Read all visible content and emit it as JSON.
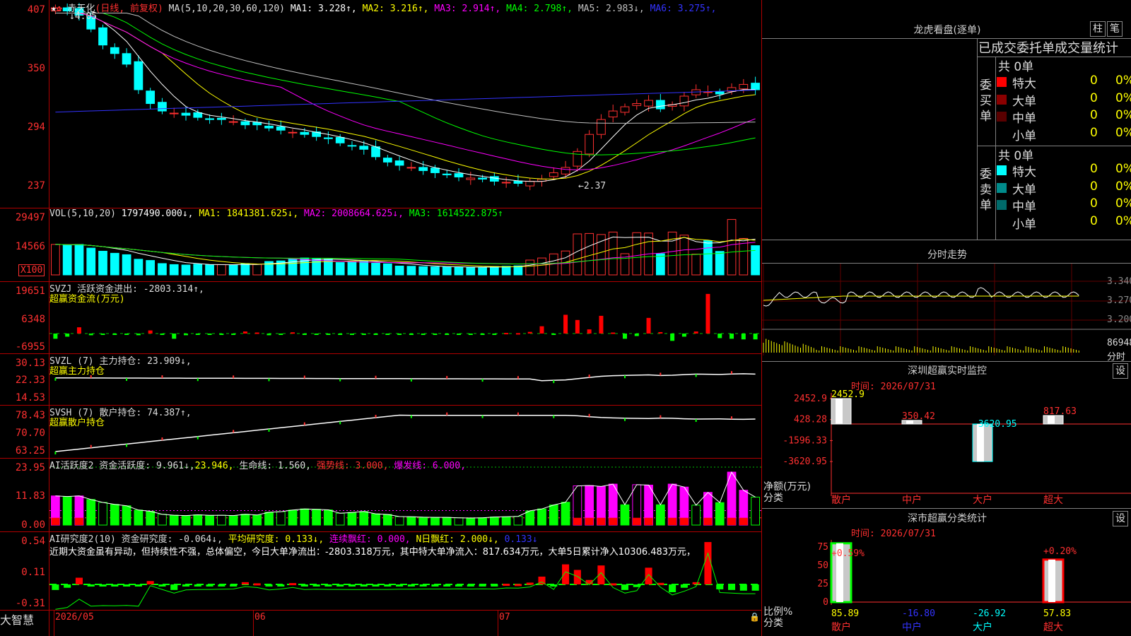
{
  "header": {
    "stock_name": "赤天化",
    "mode": "(日线, 前复权)",
    "ma_label": "MA(5,10,20,30,60,120)",
    "ma": [
      {
        "label": "MA1:",
        "value": "3.228",
        "arrow": "↑",
        "color": "#ffffff"
      },
      {
        "label": "MA2:",
        "value": "3.216",
        "arrow": "↑",
        "color": "#ffff00"
      },
      {
        "label": "MA3:",
        "value": "2.914",
        "arrow": "↑",
        "color": "#ff00ff"
      },
      {
        "label": "MA4:",
        "value": "2.798",
        "arrow": "↑",
        "color": "#00ff00"
      },
      {
        "label": "MA5:",
        "value": "2.983",
        "arrow": "↓",
        "color": "#c0c0c0"
      },
      {
        "label": "MA6:",
        "value": "3.275",
        "arrow": "↑",
        "color": "#3333ff"
      }
    ],
    "high_mark": "4.05",
    "low_mark": "←2.37"
  },
  "price_axis": [
    "407",
    "350",
    "294",
    "237"
  ],
  "vol": {
    "title": "VOL(5,10,20)",
    "value": "1797490.000↓,",
    "ma1": "MA1: 1841381.625↓,",
    "ma2": "MA2: 2008664.625↓,",
    "ma3": "MA3: 1614522.875↑",
    "axis": [
      "29497",
      "14566"
    ],
    "unit": "X100"
  },
  "svzj": {
    "line1": "SVZJ  活跃资金进出: -2803.314↑,",
    "line2": "超赢资金流(万元)",
    "axis": [
      "19651",
      "6348",
      "-6955"
    ]
  },
  "svzl": {
    "line1": "SVZL (7) 主力持仓: 23.909↓,",
    "line2": "超赢主力持仓",
    "axis": [
      "30.13",
      "22.33",
      "14.53"
    ]
  },
  "svsh": {
    "line1": "SVSH (7) 散户持仓: 74.387↑,",
    "line2": "超赢散户持仓",
    "axis": [
      "78.43",
      "70.70",
      "63.25"
    ]
  },
  "ai1": {
    "a": "AI活跃度2 资金活跃度: 9.961↓,",
    "b": "23.946,",
    "c": "生命线: 1.560,",
    "d": "强势线: 3.000,",
    "e": "爆发线: 6.000,",
    "axis": [
      "23.95",
      "11.83",
      "0.00"
    ]
  },
  "ai2": {
    "a": "AI研究度2(10) 资金研究度: -0.064↓,",
    "b": "平均研究度: 0.133↓,",
    "c": "连续飘红: 0.000,",
    "d": "N日飘红: 2.000↓,",
    "e": "0.133↓",
    "text": "近期大资金虽有异动，但持续性不强，总体偏空，今日大单净流出：-2803.318万元，其中特大单净流入：817.634万元，大单5日累计净入10306.483万元，",
    "axis": [
      "0.54",
      "0.11",
      "-0.31"
    ]
  },
  "bottom": {
    "logo": "大智慧",
    "dates": [
      "2026/05",
      "06",
      "07"
    ]
  },
  "right": {
    "longhu_title": "龙虎看盘(逐单)",
    "btn1": "柱",
    "btn2": "笔",
    "tabs_line": "已成交委托单成交量统计",
    "buy_label": [
      "委",
      "买",
      "单"
    ],
    "sell_label": [
      "委",
      "卖",
      "单"
    ],
    "buy_total": "共 0单",
    "sell_total": "共 0单",
    "buy_rows": [
      {
        "name": "特大",
        "n": "0",
        "pct": "0%",
        "color": "#ff0000"
      },
      {
        "name": "大单",
        "n": "0",
        "pct": "0%",
        "color": "#8b0000"
      },
      {
        "name": "中单",
        "n": "0",
        "pct": "0%",
        "color": "#5a0000"
      },
      {
        "name": "小单",
        "n": "0",
        "pct": "0%",
        "color": ""
      }
    ],
    "sell_rows": [
      {
        "name": "特大",
        "n": "0",
        "pct": "0%",
        "color": "#00ffff"
      },
      {
        "name": "大单",
        "n": "0",
        "pct": "0%",
        "color": "#008b8b"
      },
      {
        "name": "中单",
        "n": "0",
        "pct": "0%",
        "color": "#006b6b"
      },
      {
        "name": "小单",
        "n": "0",
        "pct": "0%",
        "color": ""
      }
    ],
    "intraday_title": "分时走势",
    "intraday_axis": [
      "3.340",
      "3.270",
      "3.200"
    ],
    "intraday_vol": "86948",
    "intraday_sub": "分时",
    "sz_title": "深圳超赢实时监控",
    "sz_setting": "设",
    "sz_time": "时间: 2026/07/31",
    "sz_axis": [
      "2452.9",
      "428.28",
      "-1596.33",
      "-3620.95"
    ],
    "sz_values": [
      {
        "label": "2452.9",
        "color": "#ffff00"
      },
      {
        "label": "350.42",
        "color": "#ff3030"
      },
      {
        "label": "-3620.95",
        "color": "#00ffff"
      },
      {
        "label": "817.63",
        "color": "#ff3030"
      }
    ],
    "sz_ylabel": "净额(万元)",
    "sz_xlabel": "分类",
    "sz_cats": [
      "散户",
      "中户",
      "大户",
      "超大"
    ],
    "fl_title": "深市超赢分类统计",
    "fl_setting": "设",
    "fl_time": "时间: 2026/07/31",
    "fl_axis": [
      "75",
      "50",
      "25",
      "0"
    ],
    "fl_top": [
      "+0.59%",
      "+0.20%"
    ],
    "fl_values": [
      {
        "label": "85.89",
        "color": "#ffff00"
      },
      {
        "label": "-16.80",
        "color": "#3333ff"
      },
      {
        "label": "-26.92",
        "color": "#00ffff"
      },
      {
        "label": "57.83",
        "color": "#ffff00"
      }
    ],
    "fl_ylabel": "比例%",
    "fl_xlabel": "分类",
    "fl_cats": [
      "散户",
      "中户",
      "大户",
      "超大"
    ]
  },
  "chart_data": [
    {
      "type": "candlestick",
      "title": "赤天化 (日线, 前复权)",
      "ylim": [
        2.37,
        4.07
      ],
      "close": [
        4.05,
        4.02,
        3.98,
        3.85,
        3.7,
        3.62,
        3.52,
        3.28,
        3.15,
        3.08,
        3.06,
        3.04,
        3.02,
        3.0,
        3.0,
        2.98,
        2.95,
        2.95,
        2.92,
        2.9,
        2.88,
        2.86,
        2.84,
        2.82,
        2.78,
        2.75,
        2.72,
        2.65,
        2.6,
        2.57,
        2.55,
        2.52,
        2.5,
        2.48,
        2.46,
        2.45,
        2.44,
        2.42,
        2.41,
        2.4,
        2.42,
        2.44,
        2.5,
        2.55,
        2.7,
        2.86,
        3.0,
        3.08,
        3.12,
        3.15,
        3.18,
        3.1,
        3.14,
        3.22,
        3.28,
        3.26,
        3.24,
        3.3,
        3.33,
        3.28
      ],
      "ma_values": {
        "MA1": 3.228,
        "MA2": 3.216,
        "MA3": 2.914,
        "MA4": 2.798,
        "MA5": 2.983,
        "MA6": 3.275
      }
    },
    {
      "type": "bar",
      "title": "VOL(5,10,20)",
      "ylim": [
        0,
        29497
      ],
      "values": [
        14800,
        14500,
        14800,
        13000,
        11500,
        10500,
        9800,
        7600,
        7000,
        5500,
        5000,
        4800,
        5200,
        4900,
        5000,
        4800,
        5500,
        5100,
        6500,
        6800,
        7600,
        8200,
        8000,
        7700,
        6000,
        6400,
        6900,
        5700,
        5400,
        4300,
        4200,
        4000,
        3900,
        3900,
        3700,
        3600,
        3700,
        4100,
        4200,
        4400,
        7200,
        8200,
        10200,
        11600,
        19900,
        20100,
        19600,
        20800,
        10300,
        20500,
        20300,
        10300,
        20800,
        19300,
        10100,
        16600,
        11400,
        26900,
        17700,
        14200
      ]
    },
    {
      "type": "bar",
      "title": "超赢资金流(万元)",
      "ylim": [
        -6955,
        19651
      ],
      "values": [
        -2500,
        -1500,
        3000,
        -800,
        -500,
        -600,
        -400,
        -800,
        1500,
        -500,
        -2500,
        -800,
        -600,
        -500,
        -400,
        -300,
        1000,
        500,
        -800,
        -300,
        600,
        -600,
        -400,
        -500,
        -500,
        -600,
        -600,
        -500,
        -500,
        -400,
        -400,
        -300,
        -300,
        -300,
        -200,
        -300,
        -200,
        -300,
        300,
        200,
        800,
        3500,
        -500,
        9000,
        6500,
        2000,
        8500,
        500,
        -2500,
        -1200,
        7500,
        700,
        -3500,
        -1500,
        1000,
        19000,
        -2200,
        -2500,
        -2800,
        -2803
      ]
    }
  ]
}
